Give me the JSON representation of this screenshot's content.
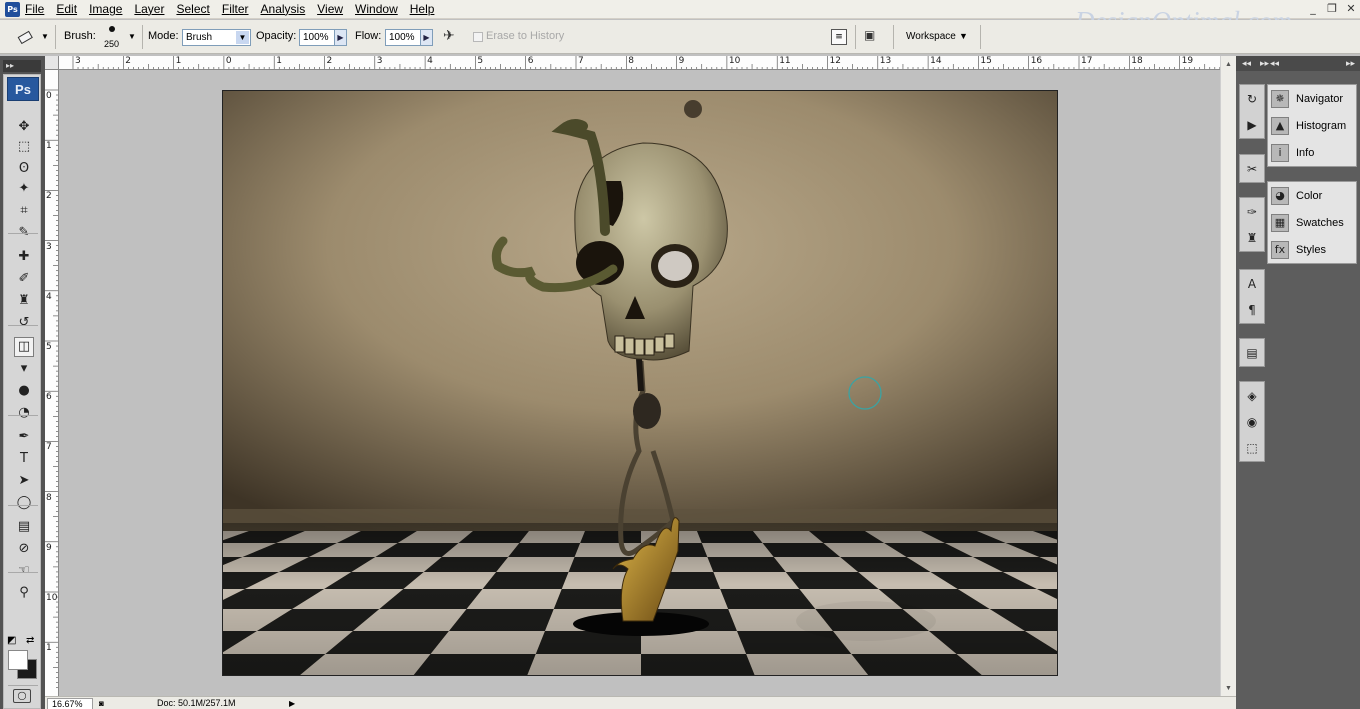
{
  "app": {
    "icon_text": "Ps",
    "watermark": "DesignOptimal.com"
  },
  "menu": {
    "items": [
      "File",
      "Edit",
      "Image",
      "Layer",
      "Select",
      "Filter",
      "Analysis",
      "View",
      "Window",
      "Help"
    ]
  },
  "window_controls": {
    "minimize": "_",
    "restore": "❐",
    "close": "✕"
  },
  "options_bar": {
    "brush_label": "Brush:",
    "brush_size": "250",
    "mode_label": "Mode:",
    "mode_value": "Brush",
    "opacity_label": "Opacity:",
    "opacity_value": "100%",
    "flow_label": "Flow:",
    "flow_value": "100%",
    "erase_history_label": "Erase to History",
    "workspace_label": "Workspace"
  },
  "toolbox": {
    "logo": "Ps",
    "tools": [
      {
        "name": "move-tool",
        "glyph": "✥"
      },
      {
        "name": "marquee-tool",
        "glyph": "⬚"
      },
      {
        "name": "lasso-tool",
        "glyph": "ʘ"
      },
      {
        "name": "magic-wand-tool",
        "glyph": "✦"
      },
      {
        "name": "crop-tool",
        "glyph": "⌗"
      },
      {
        "name": "eyedropper-tool",
        "glyph": "✎"
      },
      {
        "name": "healing-brush-tool",
        "glyph": "✚"
      },
      {
        "name": "brush-tool",
        "glyph": "✐"
      },
      {
        "name": "clone-stamp-tool",
        "glyph": "♜"
      },
      {
        "name": "history-brush-tool",
        "glyph": "↺"
      },
      {
        "name": "eraser-tool",
        "glyph": "◫"
      },
      {
        "name": "paint-bucket-tool",
        "glyph": "▾"
      },
      {
        "name": "blur-tool",
        "glyph": "●"
      },
      {
        "name": "dodge-tool",
        "glyph": "◔"
      },
      {
        "name": "pen-tool",
        "glyph": "✒"
      },
      {
        "name": "type-tool",
        "glyph": "T"
      },
      {
        "name": "path-selection-tool",
        "glyph": "➤"
      },
      {
        "name": "shape-tool",
        "glyph": "◯"
      },
      {
        "name": "notes-tool",
        "glyph": "▤"
      },
      {
        "name": "eyedropper-sample-tool",
        "glyph": "⊘"
      },
      {
        "name": "hand-tool",
        "glyph": "☜"
      },
      {
        "name": "zoom-tool",
        "glyph": "⚲"
      }
    ],
    "active_tool": "eraser-tool"
  },
  "ruler": {
    "top_labels": [
      "3",
      "2",
      "1",
      "0",
      "1",
      "2",
      "3",
      "4",
      "5",
      "6",
      "7",
      "8",
      "9",
      "10",
      "11",
      "12",
      "13",
      "14",
      "15",
      "16",
      "17",
      "18",
      "19"
    ],
    "left_labels": [
      "0",
      "1",
      "2",
      "3",
      "4",
      "5",
      "6",
      "7",
      "8",
      "9",
      "10",
      "1"
    ]
  },
  "status": {
    "zoom": "16.67%",
    "doc": "Doc: 50.1M/257.1M"
  },
  "panels": {
    "group1": [
      {
        "label": "Navigator",
        "icon": "navigator-icon",
        "glyph": "✵"
      },
      {
        "label": "Histogram",
        "icon": "histogram-icon",
        "glyph": "▲"
      },
      {
        "label": "Info",
        "icon": "info-icon",
        "glyph": "i"
      }
    ],
    "group2": [
      {
        "label": "Color",
        "icon": "color-icon",
        "glyph": "◕"
      },
      {
        "label": "Swatches",
        "icon": "swatches-icon",
        "glyph": "▦"
      },
      {
        "label": "Styles",
        "icon": "styles-icon",
        "glyph": "fx"
      }
    ]
  },
  "colors": {
    "toolbox_bg": "#535353",
    "dock_bg": "#5d5d5d",
    "canvas_bg": "#c0c0c0",
    "ps_blue": "#27589e",
    "floor_dark": "#1c1c1a",
    "floor_light": "#c6bdb0"
  }
}
